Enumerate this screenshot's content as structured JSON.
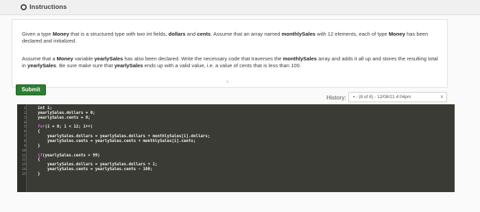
{
  "header": {
    "title": "Instructions"
  },
  "instructions": {
    "p1": {
      "t1": "Given a type ",
      "b1": "Money",
      "t2": " that is a structured type with two int fields, ",
      "b2": "dollars",
      "t3": " and ",
      "b3": "cents",
      "t4": ". Assume that an array named ",
      "b4": "monthlySales",
      "t5": " with 12 elements, each of type ",
      "b5": "Money",
      "t6": " has been declared and initialized."
    },
    "p2": {
      "t1": "Assume that a ",
      "b1": "Money",
      "t2": " variable ",
      "b2": "yearlySales",
      "t3": " has also been declared. Write the necessary code that traverses the ",
      "b3": "monthlySales",
      "t4": " array and adds it all up and stores the resulting total in ",
      "b4": "yearlySales",
      "t5": ". Be sure make sure that ",
      "b5": "yearlySales",
      "t6": " ends up with a valid value, i.e. a value of cents that is less than 100."
    },
    "chevron": "∨"
  },
  "submit": {
    "label": "Submit"
  },
  "history": {
    "label": "History:",
    "value": "▪ - (8 of 8) - 12/08/21 4:04pm",
    "caret": "∨"
  },
  "editor": {
    "lines": [
      {
        "n": "1",
        "segs": [
          {
            "t": "int i;"
          }
        ]
      },
      {
        "n": "2",
        "segs": [
          {
            "t": "yearlySales.dollars = 0;"
          }
        ]
      },
      {
        "n": "3",
        "segs": [
          {
            "t": "yearlySales.cents = 0;"
          }
        ]
      },
      {
        "n": "4",
        "segs": []
      },
      {
        "n": "5",
        "segs": [
          {
            "t": "for",
            "c": "kw"
          },
          {
            "t": "(i = 0; i < 12; i++)"
          }
        ]
      },
      {
        "n": "6",
        "segs": [
          {
            "t": "{"
          }
        ]
      },
      {
        "n": "7",
        "segs": [
          {
            "t": "    yearlySales.dollars = yearlySales.dollars + monthlySales[i].dollars;"
          }
        ]
      },
      {
        "n": "8",
        "segs": [
          {
            "t": "    yearlySales.cents = yearlySales.cents + monthlySales[i].cents;"
          }
        ]
      },
      {
        "n": "9",
        "segs": [
          {
            "t": "}"
          }
        ]
      },
      {
        "n": "10",
        "segs": []
      },
      {
        "n": "11",
        "segs": [
          {
            "t": "if",
            "c": "kw"
          },
          {
            "t": "(yearlySales.cents > 99)"
          }
        ]
      },
      {
        "n": "12",
        "segs": [
          {
            "t": "{"
          }
        ]
      },
      {
        "n": "13",
        "segs": [
          {
            "t": "    yearlySales.dollars = yearlySales.dollars + 1;"
          }
        ]
      },
      {
        "n": "14",
        "segs": [
          {
            "t": "    yearlySales.cents = yearlySales.cents - 100;"
          }
        ]
      },
      {
        "n": "15",
        "segs": [
          {
            "t": "}"
          }
        ]
      }
    ]
  }
}
